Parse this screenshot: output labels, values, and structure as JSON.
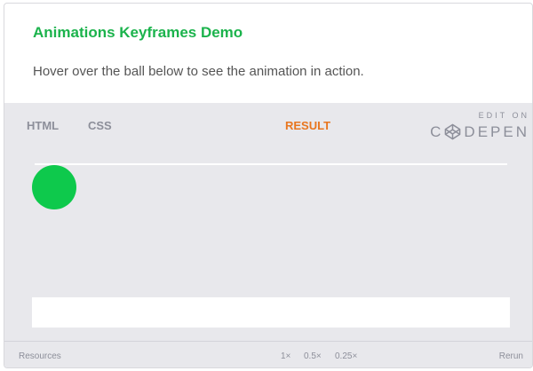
{
  "header": {
    "title": "Animations Keyframes Demo",
    "subtitle": "Hover over the ball below to see the animation in action."
  },
  "embed": {
    "tabs": [
      {
        "label": "HTML",
        "active": false
      },
      {
        "label": "CSS",
        "active": false
      },
      {
        "label": "RESULT",
        "active": true
      }
    ],
    "codepen": {
      "edit_on": "EDIT ON",
      "brand_left": "C",
      "brand_right": "DEPEN",
      "icon": "codepen-logo-icon"
    },
    "result": {
      "ball_color": "#0ec94c"
    },
    "footer": {
      "resources": "Resources",
      "speeds": [
        "1×",
        "0.5×",
        "0.25×"
      ],
      "rerun": "Rerun"
    }
  },
  "colors": {
    "title": "#1bb34c",
    "active_tab": "#e8761f",
    "embed_bg": "#e8e8ec"
  }
}
